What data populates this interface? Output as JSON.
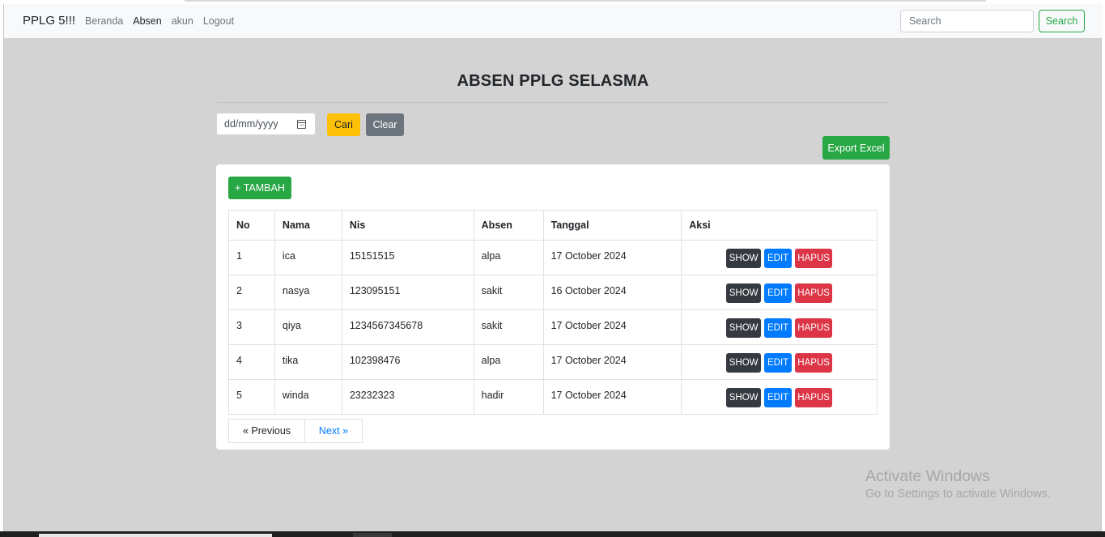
{
  "navbar": {
    "brand": "PPLG 5!!!",
    "links": [
      {
        "label": "Beranda",
        "active": false
      },
      {
        "label": "Absen",
        "active": true
      },
      {
        "label": "akun",
        "active": false
      },
      {
        "label": "Logout",
        "active": false
      }
    ],
    "search_placeholder": "Search",
    "search_button": "Search"
  },
  "page": {
    "title": "ABSEN PPLG SELASMA",
    "date_placeholder": "dd/mm/yyyy",
    "cari_label": "Cari",
    "clear_label": "Clear",
    "export_label": "Export Excel",
    "tambah_label": "+ TAMBAH"
  },
  "table": {
    "headers": [
      "No",
      "Nama",
      "Nis",
      "Absen",
      "Tanggal",
      "Aksi"
    ],
    "rows": [
      {
        "no": "1",
        "nama": "ica",
        "nis": "15151515",
        "absen": "alpa",
        "tanggal": "17 October 2024"
      },
      {
        "no": "2",
        "nama": "nasya",
        "nis": "123095151",
        "absen": "sakit",
        "tanggal": "16 October 2024"
      },
      {
        "no": "3",
        "nama": "qiya",
        "nis": "1234567345678",
        "absen": "sakit",
        "tanggal": "17 October 2024"
      },
      {
        "no": "4",
        "nama": "tika",
        "nis": "102398476",
        "absen": "alpa",
        "tanggal": "17 October 2024"
      },
      {
        "no": "5",
        "nama": "winda",
        "nis": "23232323",
        "absen": "hadir",
        "tanggal": "17 October 2024"
      }
    ],
    "actions": {
      "show": "SHOW",
      "edit": "EDIT",
      "hapus": "HAPUS"
    }
  },
  "pagination": {
    "previous": "« Previous",
    "next": "Next »"
  },
  "watermark": {
    "title": "Activate Windows",
    "subtitle": "Go to Settings to activate Windows."
  },
  "colors": {
    "success": "#28a745",
    "warning": "#ffc107",
    "secondary": "#6c757d",
    "dark": "#343a40",
    "primary": "#007bff",
    "danger": "#dc3545",
    "page_bg": "#d3d3d3"
  }
}
